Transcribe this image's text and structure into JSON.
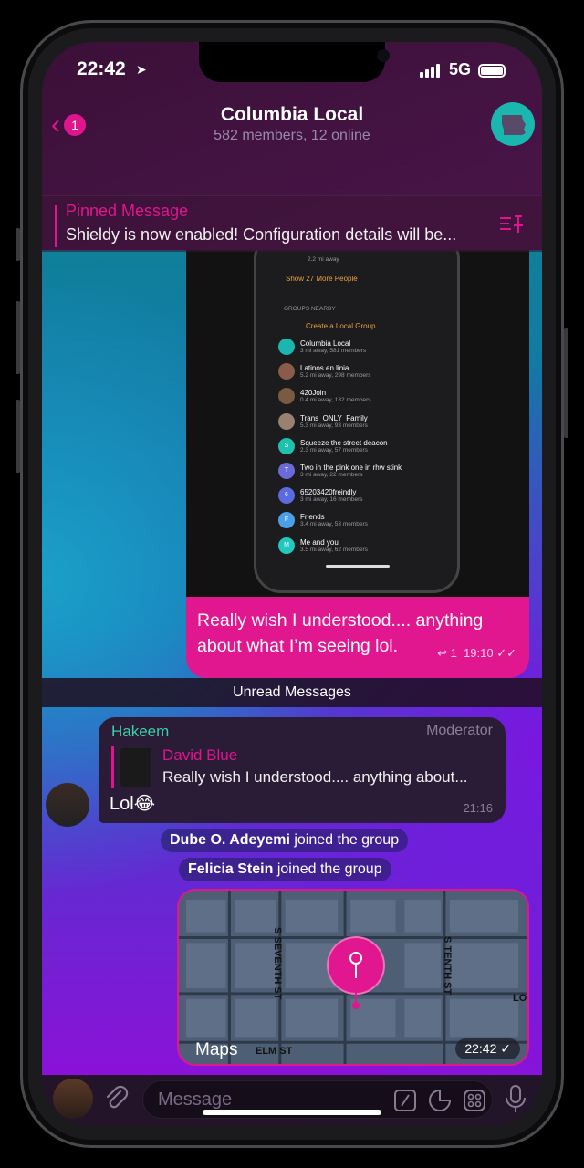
{
  "status": {
    "time": "22:42",
    "network": "5G"
  },
  "header": {
    "title": "Columbia Local",
    "subtitle": "582 members, 12 online",
    "back_count": "1"
  },
  "pinned": {
    "title": "Pinned Message",
    "text": "Shieldy is now enabled! Configuration details will be..."
  },
  "screenshot": {
    "top_item_distance": "2.2 mi away",
    "show_more": "Show 27 More People",
    "section": "GROUPS NEARBY",
    "create": "Create a Local Group",
    "groups": [
      {
        "name": "Columbia Local",
        "sub": "3 mi away, 581 members",
        "color": "#19b7b0"
      },
      {
        "name": "Latinos en linia",
        "sub": "5.2 mi away, 298 members",
        "color": "#8a5a4a"
      },
      {
        "name": "420Join",
        "sub": "0.4 mi away, 132 members",
        "color": "#7a5a40"
      },
      {
        "name": "Trans_ONLY_Family",
        "sub": "5.3 mi away, 93 members",
        "color": "#9a8070"
      },
      {
        "name": "Squeeze the street deacon",
        "sub": "2.3 mi away, 57 members",
        "color": "#20c0b0",
        "letter": "S"
      },
      {
        "name": "Two in the pink one in rhw stink",
        "sub": "3 mi away, 22 members",
        "color": "#6a6ad8",
        "letter": "T"
      },
      {
        "name": "65203420freindly",
        "sub": "3 mi away, 16 members",
        "color": "#5a6ae0",
        "letter": "6"
      },
      {
        "name": "Friends",
        "sub": "3.4 mi away, 53 members",
        "color": "#4aa0e8",
        "letter": "F"
      },
      {
        "name": "Me and you",
        "sub": "3.5 mi away, 62 members",
        "color": "#20c8c0",
        "letter": "M"
      }
    ]
  },
  "bubble": {
    "text": "Really wish I understood.... anything about what I’m seeing lol.",
    "replies": "1",
    "time": "19:10"
  },
  "unread": "Unread Messages",
  "message": {
    "sender": "Hakeem",
    "role": "Moderator",
    "reply_name": "David Blue",
    "reply_text": "Really wish I understood.... anything about...",
    "text": "Lol😂",
    "time": "21:16"
  },
  "system": [
    {
      "name": "Dube O. Adeyemi",
      "action": "joined the group"
    },
    {
      "name": "Felicia Stein",
      "action": "joined the group"
    }
  ],
  "map": {
    "logo": "Maps",
    "streets": [
      "S SEVENTH ST",
      "S TENTH ST",
      "ELM ST",
      "LOC"
    ],
    "time": "22:42"
  },
  "input": {
    "placeholder": "Message"
  },
  "colors": {
    "accent": "#e0158e",
    "sender": "#3ad0a8"
  }
}
